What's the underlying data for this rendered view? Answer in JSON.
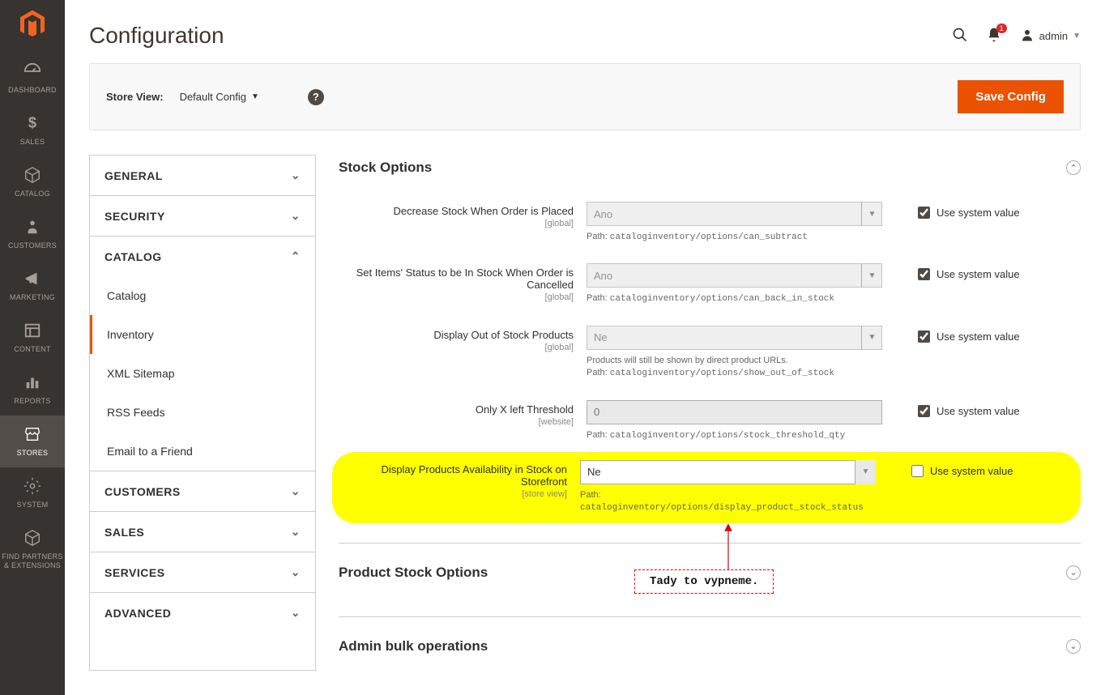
{
  "header": {
    "title": "Configuration",
    "admin_label": "admin",
    "bell_count": "1"
  },
  "storebar": {
    "label": "Store View:",
    "value": "Default Config",
    "save": "Save Config"
  },
  "nav": [
    {
      "label": "DASHBOARD"
    },
    {
      "label": "SALES"
    },
    {
      "label": "CATALOG"
    },
    {
      "label": "CUSTOMERS"
    },
    {
      "label": "MARKETING"
    },
    {
      "label": "CONTENT"
    },
    {
      "label": "REPORTS"
    },
    {
      "label": "STORES"
    },
    {
      "label": "SYSTEM"
    },
    {
      "label": "FIND PARTNERS & EXTENSIONS"
    }
  ],
  "confignav": {
    "general": "GENERAL",
    "security": "SECURITY",
    "catalog": "CATALOG",
    "catalog_items": [
      "Catalog",
      "Inventory",
      "XML Sitemap",
      "RSS Feeds",
      "Email to a Friend"
    ],
    "customers": "CUSTOMERS",
    "sales": "SALES",
    "services": "SERVICES",
    "advanced": "ADVANCED"
  },
  "sections": {
    "stock_options": "Stock Options",
    "product_stock_options": "Product Stock Options",
    "admin_bulk": "Admin bulk operations"
  },
  "use_system_value": "Use system value",
  "path_prefix": "Path: ",
  "fields": {
    "f1": {
      "label": "Decrease Stock When Order is Placed",
      "scope": "[global]",
      "value": "Ano",
      "path": "cataloginventory/options/can_subtract"
    },
    "f2": {
      "label": "Set Items' Status to be In Stock When Order is Cancelled",
      "scope": "[global]",
      "value": "Ano",
      "path": "cataloginventory/options/can_back_in_stock"
    },
    "f3": {
      "label": "Display Out of Stock Products",
      "scope": "[global]",
      "value": "Ne",
      "note": "Products will still be shown by direct product URLs.",
      "path": "cataloginventory/options/show_out_of_stock"
    },
    "f4": {
      "label": "Only X left Threshold",
      "scope": "[website]",
      "value": "0",
      "path": "cataloginventory/options/stock_threshold_qty"
    },
    "f5": {
      "label": "Display Products Availability in Stock on Storefront",
      "scope": "[store view]",
      "value": "Ne",
      "path": "cataloginventory/options/display_product_stock_status"
    }
  },
  "annotation": "Tady to vypneme."
}
